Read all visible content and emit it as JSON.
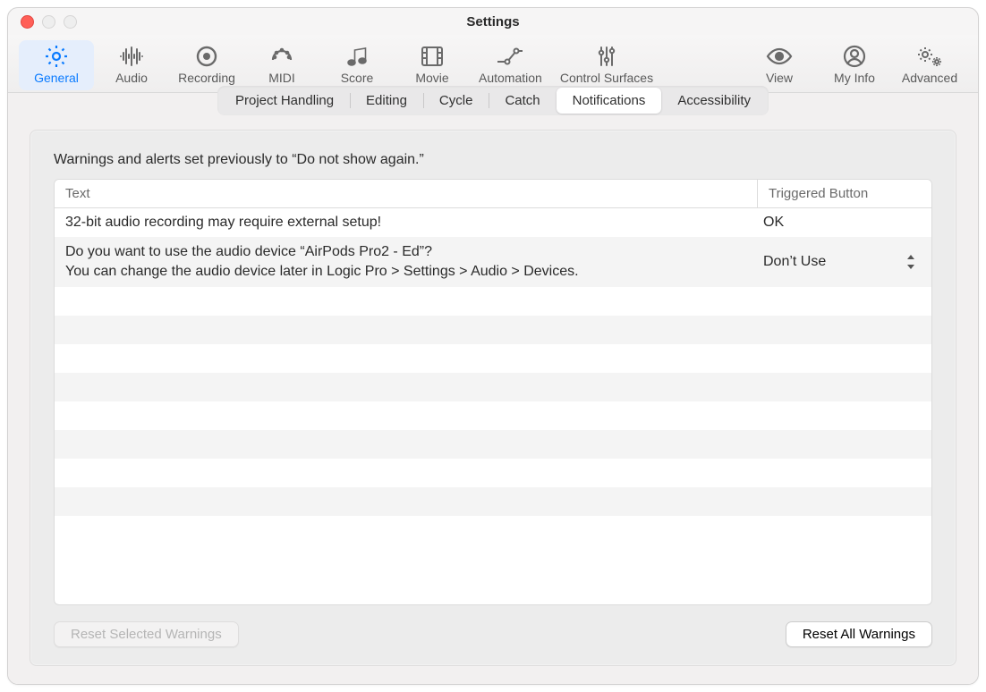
{
  "window": {
    "title": "Settings"
  },
  "toolbar": [
    {
      "label": "General",
      "selected": true
    },
    {
      "label": "Audio"
    },
    {
      "label": "Recording"
    },
    {
      "label": "MIDI"
    },
    {
      "label": "Score"
    },
    {
      "label": "Movie"
    },
    {
      "label": "Automation"
    },
    {
      "label": "Control Surfaces"
    },
    {
      "label": "View"
    },
    {
      "label": "My Info"
    },
    {
      "label": "Advanced"
    }
  ],
  "subtabs": [
    {
      "label": "Project Handling"
    },
    {
      "label": "Editing"
    },
    {
      "label": "Cycle"
    },
    {
      "label": "Catch"
    },
    {
      "label": "Notifications",
      "selected": true
    },
    {
      "label": "Accessibility"
    }
  ],
  "panel": {
    "description": "Warnings and alerts set previously to “Do not show again.”"
  },
  "table": {
    "columns": [
      "Text",
      "Triggered Button"
    ],
    "rows": [
      {
        "text": "32-bit audio recording may require external setup!",
        "triggered": "OK"
      },
      {
        "text_line1": "Do you want to use the audio device “AirPods Pro2 - Ed”?",
        "text_line2": "You can change the audio device later in Logic Pro > Settings > Audio > Devices.",
        "triggered": "Don’t Use",
        "has_popup": true
      }
    ]
  },
  "buttons": {
    "reset_selected": "Reset Selected Warnings",
    "reset_selected_enabled": false,
    "reset_all": "Reset All Warnings",
    "reset_all_enabled": true
  }
}
